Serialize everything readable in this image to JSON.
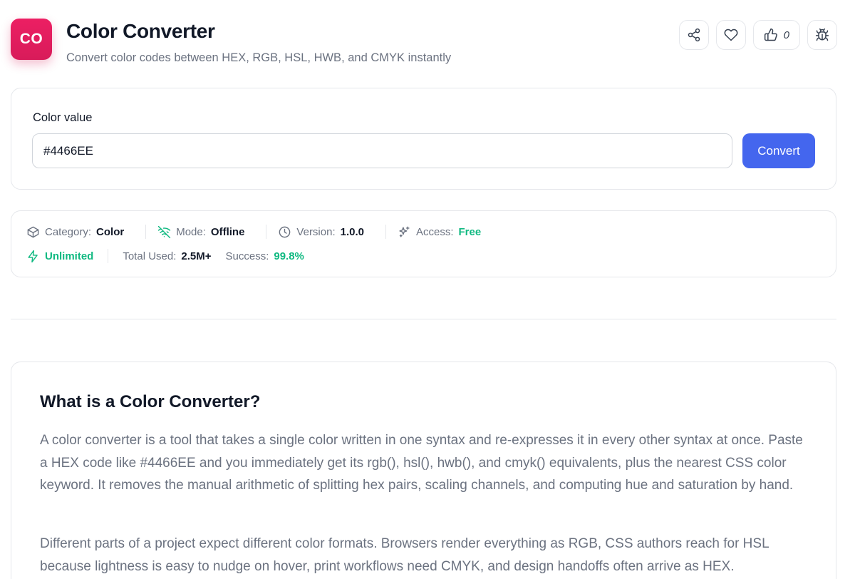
{
  "header": {
    "logo_text": "CO",
    "title": "Color Converter",
    "subtitle": "Convert color codes between HEX, RGB, HSL, HWB, and CMYK instantly",
    "like_count": "0",
    "icons": [
      "share-icon",
      "heart-icon",
      "thumbs-up-icon",
      "bug-icon"
    ]
  },
  "converter": {
    "label": "Color value",
    "value": "#4466EE",
    "button_label": "Convert"
  },
  "meta": {
    "category_label": "Category:",
    "category_value": "Color",
    "mode_label": "Mode:",
    "mode_value": "Offline",
    "version_label": "Version:",
    "version_value": "1.0.0",
    "access_label": "Access:",
    "access_value": "Free",
    "unlimited": "Unlimited",
    "total_used_label": "Total Used:",
    "total_used_value": "2.5M+",
    "success_label": "Success:",
    "success_value": "99.8%"
  },
  "about": {
    "title": "What is a Color Converter?",
    "p1": "A color converter is a tool that takes a single color written in one syntax and re-expresses it in every other syntax at once. Paste a HEX code like #4466EE and you immediately get its rgb(), hsl(), hwb(), and cmyk() equivalents, plus the nearest CSS color keyword. It removes the manual arithmetic of splitting hex pairs, scaling channels, and computing hue and saturation by hand.",
    "p2": "Different parts of a project expect different color formats. Browsers render everything as RGB, CSS authors reach for HSL because lightness is easy to nudge on hover, print workflows need CMYK, and design handoffs often arrive as HEX."
  },
  "colors": {
    "brand": "#e91e63",
    "primary": "#4466ee",
    "success": "#10b981",
    "text": "#111827",
    "muted": "#6b7280",
    "border": "#e5e7eb"
  }
}
